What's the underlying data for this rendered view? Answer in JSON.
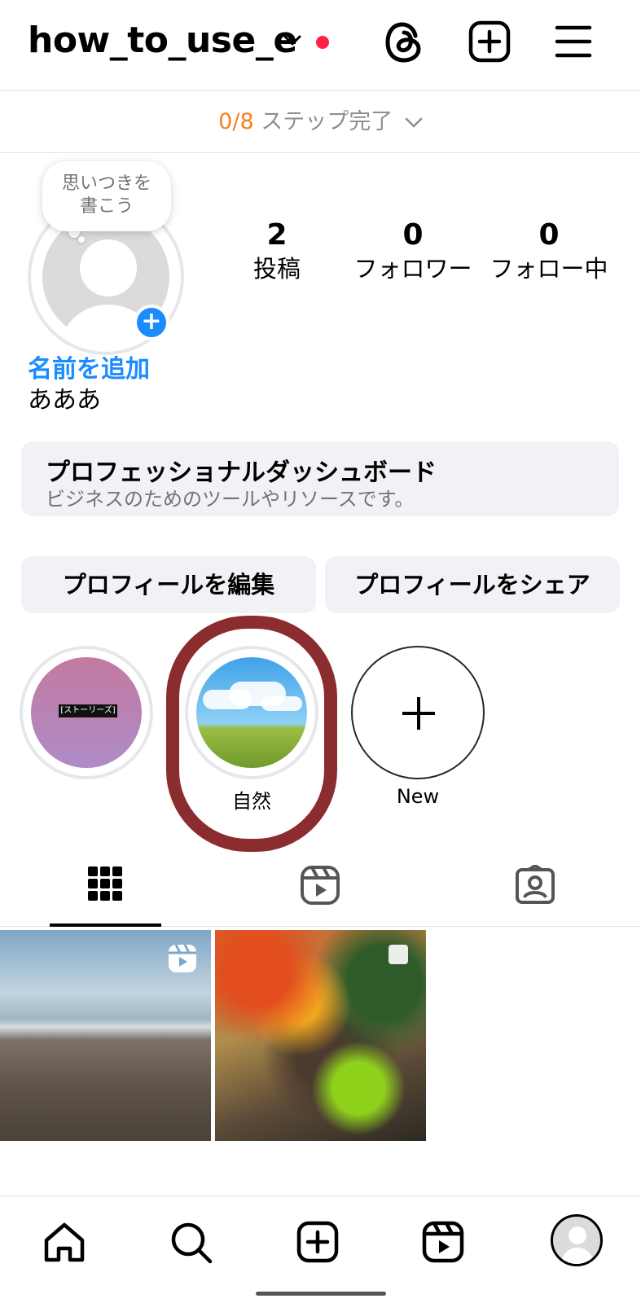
{
  "header": {
    "username": "how_to_use_e",
    "icons": [
      "chevron-down-icon",
      "notification-dot",
      "threads-icon",
      "create-icon",
      "menu-icon"
    ]
  },
  "steps": {
    "count": "0/8",
    "label": " ステップ完了"
  },
  "profile": {
    "note_bubble": "思いつきを\n書こう",
    "stats": [
      {
        "value": "2",
        "label": "投稿"
      },
      {
        "value": "0",
        "label": "フォロワー"
      },
      {
        "value": "0",
        "label": "フォロー中"
      }
    ],
    "add_name": "名前を追加",
    "bio": "あああ"
  },
  "dashboard": {
    "title": "プロフェッショナルダッシュボード",
    "subtitle": "ビジネスのためのツールやリソースです。"
  },
  "buttons": {
    "edit_profile": "プロフィールを編集",
    "share_profile": "プロフィールをシェア"
  },
  "highlights": [
    {
      "label": "",
      "tag": "[ストーリーズ]"
    },
    {
      "label": "自然"
    },
    {
      "label": "New"
    }
  ],
  "tabs": [
    "grid-icon",
    "reels-icon",
    "tagged-icon"
  ],
  "posts": [
    {
      "badge": "reel-icon"
    },
    {
      "badge": "multi-icon"
    }
  ],
  "nav": [
    "home-icon",
    "search-icon",
    "create-icon",
    "reels-icon",
    "profile-avatar"
  ],
  "colors": {
    "accent": "#1a8cff",
    "orange": "#f58220",
    "red_dot": "#ff2143",
    "annotation": "#8b2c2e"
  }
}
